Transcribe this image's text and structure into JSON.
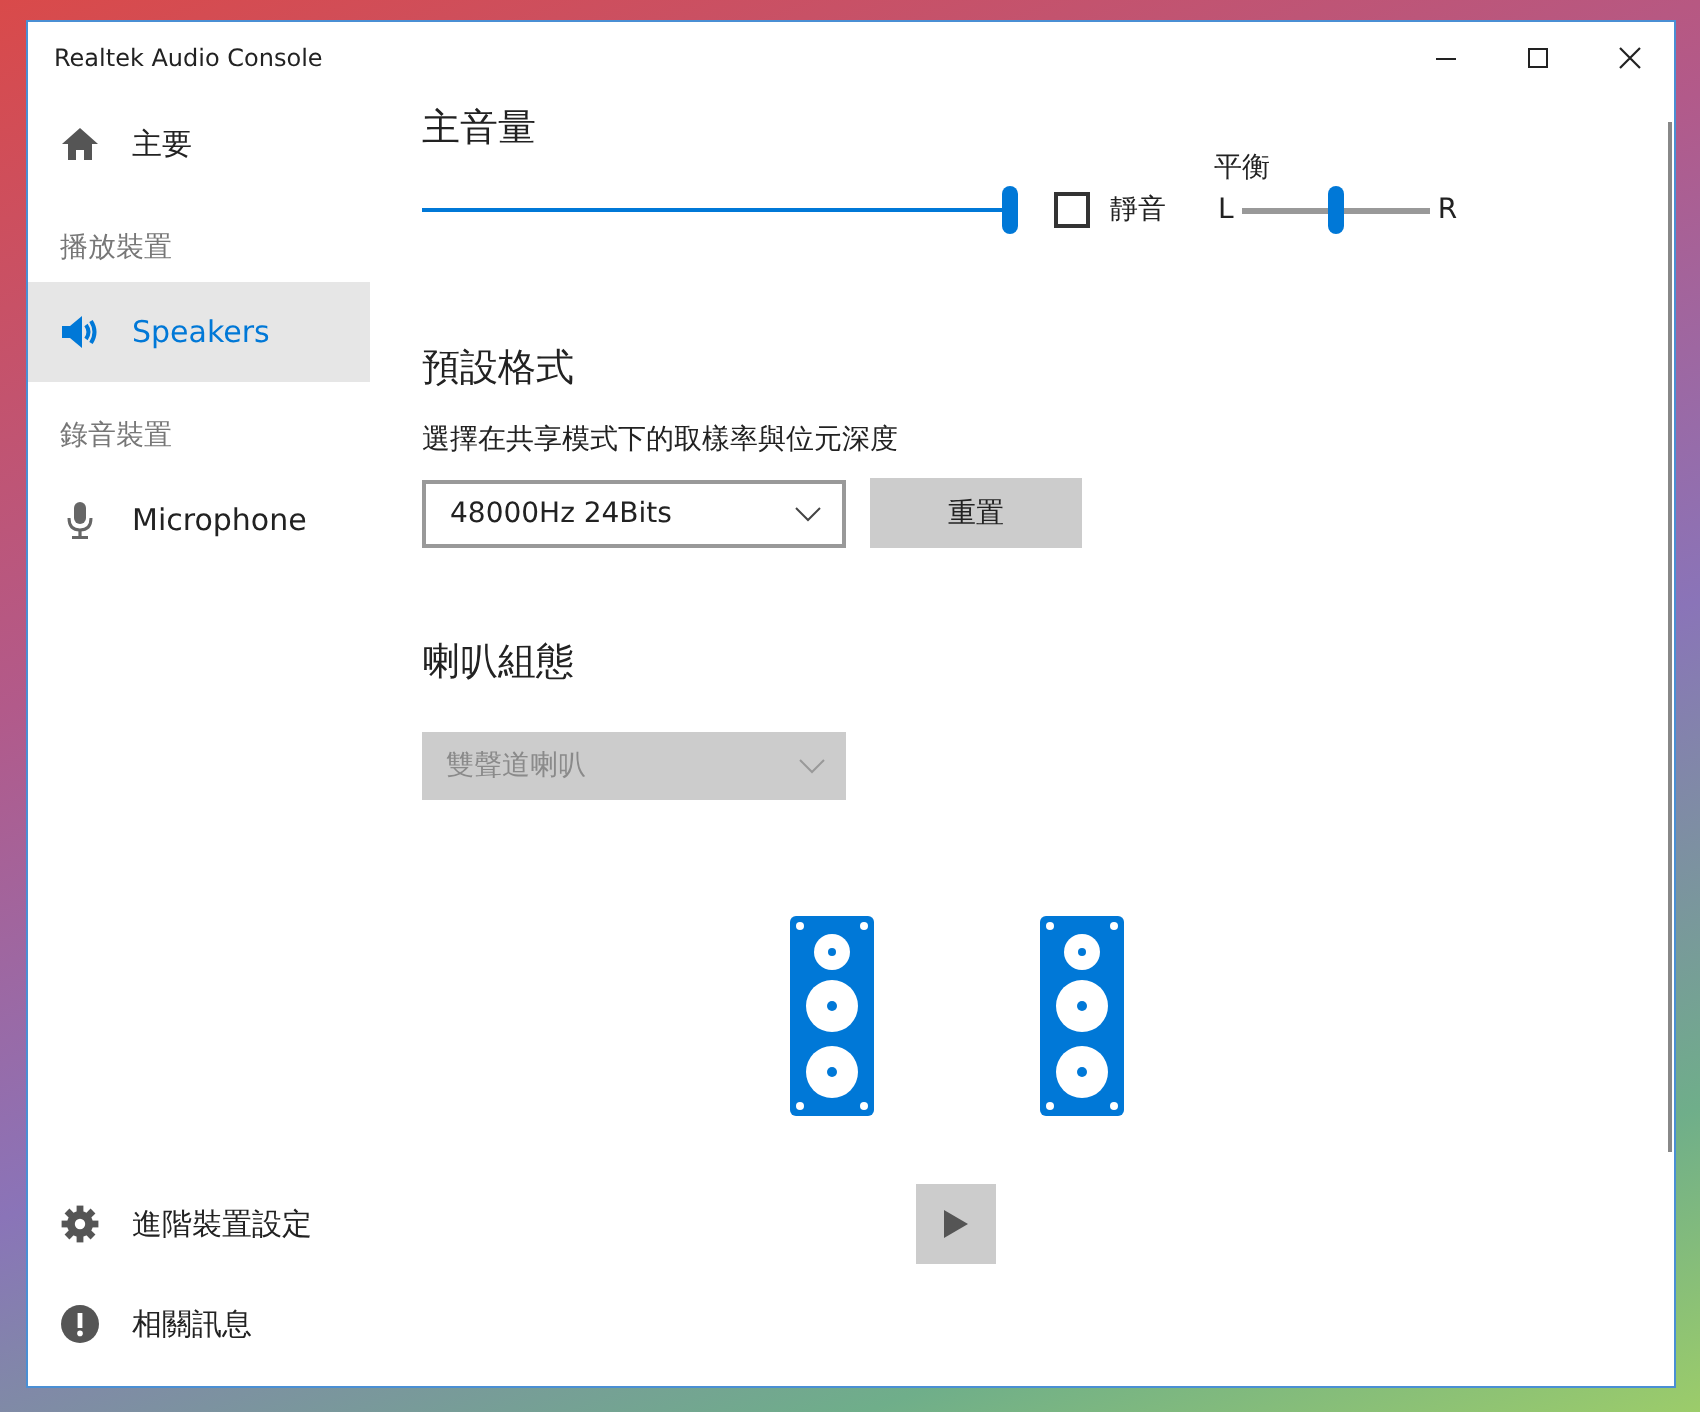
{
  "window": {
    "title": "Realtek Audio Console"
  },
  "sidebar": {
    "home": {
      "label": "主要",
      "kind": "home"
    },
    "sections": [
      {
        "header": "播放裝置",
        "devices": [
          {
            "label": "Speakers",
            "kind": "speaker",
            "selected": true
          }
        ]
      },
      {
        "header": "錄音裝置",
        "devices": [
          {
            "label": "Microphone",
            "kind": "microphone",
            "selected": false
          }
        ]
      }
    ],
    "bottom_items": [
      {
        "label": "進階裝置設定",
        "kind": "gear"
      },
      {
        "label": "相關訊息",
        "kind": "info"
      }
    ]
  },
  "master_volume": {
    "title": "主音量",
    "level": 1,
    "mute": {
      "label": "靜音",
      "checked": false
    },
    "balance": {
      "label": "平衡",
      "left": "L",
      "right": "R",
      "level": 0.5
    }
  },
  "default_format": {
    "title": "預設格式",
    "description": "選擇在共享模式下的取樣率與位元深度",
    "dropdown": {
      "value": "48000Hz 24Bits",
      "disabled": false
    },
    "reset_button": "重置"
  },
  "speaker_config": {
    "title": "喇叭組態",
    "dropdown": {
      "value": "雙聲道喇叭",
      "disabled": true
    }
  }
}
